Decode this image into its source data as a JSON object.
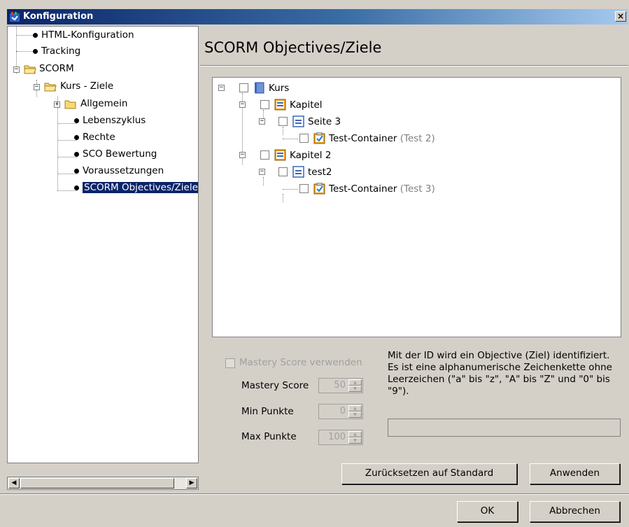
{
  "window": {
    "title": "Konfiguration",
    "close_label": "×"
  },
  "nav_tree": [
    {
      "label": "HTML-Konfiguration",
      "type": "leaf"
    },
    {
      "label": "Tracking",
      "type": "leaf"
    },
    {
      "label": "SCORM",
      "type": "folder",
      "expanded": true
    },
    {
      "label": "Kurs - Ziele",
      "type": "folder",
      "expanded": true
    },
    {
      "label": "Allgemein",
      "type": "folder",
      "expanded": false
    },
    {
      "label": "Lebenszyklus",
      "type": "leaf"
    },
    {
      "label": "Rechte",
      "type": "leaf"
    },
    {
      "label": "SCO Bewertung",
      "type": "leaf"
    },
    {
      "label": "Voraussetzungen",
      "type": "leaf"
    },
    {
      "label": "SCORM Objectives/Ziele",
      "type": "leaf",
      "selected": true
    }
  ],
  "page": {
    "heading": "SCORM Objectives/Ziele"
  },
  "objectives_tree": [
    {
      "label": "Kurs",
      "suffix": "",
      "icon": "book-icon"
    },
    {
      "label": "Kapitel",
      "suffix": "",
      "icon": "chapter-icon"
    },
    {
      "label": "Seite 3",
      "suffix": "",
      "icon": "page-icon"
    },
    {
      "label": "Test-Container",
      "suffix": "(Test 2)",
      "icon": "test-container-icon"
    },
    {
      "label": "Kapitel 2",
      "suffix": "",
      "icon": "chapter-icon"
    },
    {
      "label": "test2",
      "suffix": "",
      "icon": "page-icon"
    },
    {
      "label": "Test-Container",
      "suffix": "(Test 3)",
      "icon": "test-container-icon"
    }
  ],
  "form": {
    "mastery_checkbox_label": "Mastery Score verwenden",
    "mastery_score_label": "Mastery Score",
    "mastery_score_value": "50",
    "min_points_label": "Min Punkte",
    "min_points_value": "0",
    "max_points_label": "Max Punkte",
    "max_points_value": "100",
    "description": "Mit der ID wird ein Objective (Ziel) identifiziert. Es ist eine alphanumerische Zeichenkette ohne Leerzeichen (\"a\" bis \"z\", \"A\" bis \"Z\" und \"0\" bis \"9\").",
    "id_value": ""
  },
  "buttons": {
    "reset": "Zurücksetzen auf Standard",
    "apply": "Anwenden",
    "ok": "OK",
    "cancel": "Abbrechen"
  },
  "colors": {
    "titlebar": "#0a246a",
    "selection": "#0a246a",
    "window_bg": "#d4d0c8"
  }
}
